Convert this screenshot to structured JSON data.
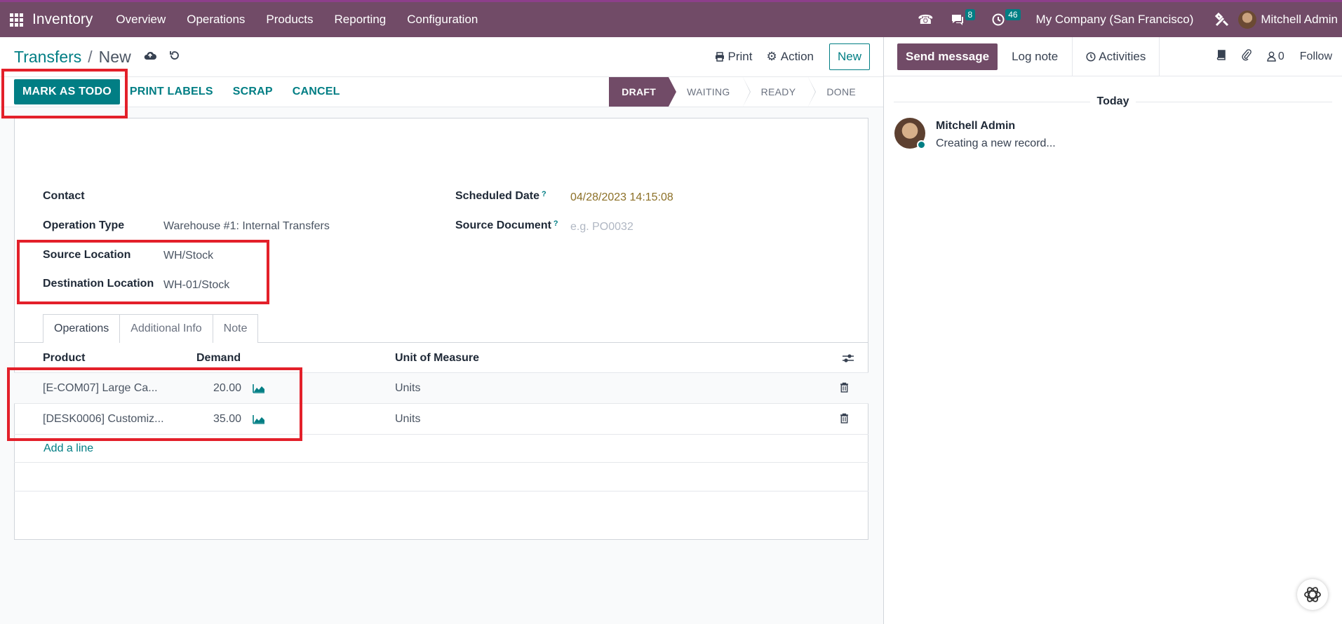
{
  "navbar": {
    "app_name": "Inventory",
    "menu": [
      "Overview",
      "Operations",
      "Products",
      "Reporting",
      "Configuration"
    ],
    "messages_count": "8",
    "activities_count": "46",
    "company": "My Company (San Francisco)",
    "user": "Mitchell Admin"
  },
  "control_panel": {
    "breadcrumb_parent": "Transfers",
    "breadcrumb_sep": "/",
    "breadcrumb_current": "New",
    "print": "Print",
    "action": "Action",
    "new": "New"
  },
  "statusbar": {
    "buttons": [
      "MARK AS TODO",
      "PRINT LABELS",
      "SCRAP",
      "CANCEL"
    ],
    "stages": [
      "DRAFT",
      "WAITING",
      "READY",
      "DONE"
    ],
    "active_stage": "DRAFT"
  },
  "form": {
    "contact_label": "Contact",
    "operation_type_label": "Operation Type",
    "operation_type_value": "Warehouse #1: Internal Transfers",
    "source_location_label": "Source Location",
    "source_location_value": "WH/Stock",
    "destination_location_label": "Destination Location",
    "destination_location_value": "WH-01/Stock",
    "scheduled_date_label": "Scheduled Date",
    "scheduled_date_value": "04/28/2023 14:15:08",
    "source_document_label": "Source Document",
    "source_document_placeholder": "e.g. PO0032",
    "help_mark": "?"
  },
  "tabs": [
    "Operations",
    "Additional Info",
    "Note"
  ],
  "table": {
    "columns": [
      "Product",
      "Demand",
      "Unit of Measure"
    ],
    "rows": [
      {
        "product": "[E-COM07] Large Ca...",
        "demand": "20.00",
        "uom": "Units"
      },
      {
        "product": "[DESK0006] Customiz...",
        "demand": "35.00",
        "uom": "Units"
      }
    ],
    "add_line": "Add a line"
  },
  "chatter": {
    "send_message": "Send message",
    "log_note": "Log note",
    "activities": "Activities",
    "followers_count": "0",
    "follow": "Follow",
    "today": "Today",
    "author": "Mitchell Admin",
    "message": "Creating a new record..."
  },
  "colors": {
    "brand": "#714b67",
    "accent": "#017e84",
    "highlight": "#e3202a"
  }
}
